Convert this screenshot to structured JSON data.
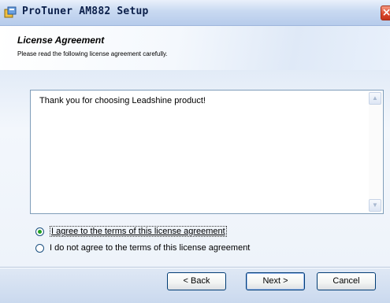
{
  "window": {
    "title": "ProTuner AM882 Setup",
    "app_icon": "setup-icon",
    "close_icon": "close-icon"
  },
  "header": {
    "title": "License Agreement",
    "subtitle": "Please read the following license agreement carefully."
  },
  "license": {
    "text": "Thank you for choosing Leadshine product!",
    "scroll_up_icon": "scroll-up-arrow-icon",
    "scroll_down_icon": "scroll-down-arrow-icon"
  },
  "options": {
    "agree": {
      "label": "I agree to the terms of this license agreement",
      "selected": true
    },
    "disagree": {
      "label": "I do not agree to the terms of this license agreement",
      "selected": false
    }
  },
  "buttons": {
    "back": "< Back",
    "next": "Next >",
    "cancel": "Cancel"
  },
  "colors": {
    "accent": "#003c74",
    "radio_selected": "#21a121",
    "title_text": "#0b1f4a"
  }
}
